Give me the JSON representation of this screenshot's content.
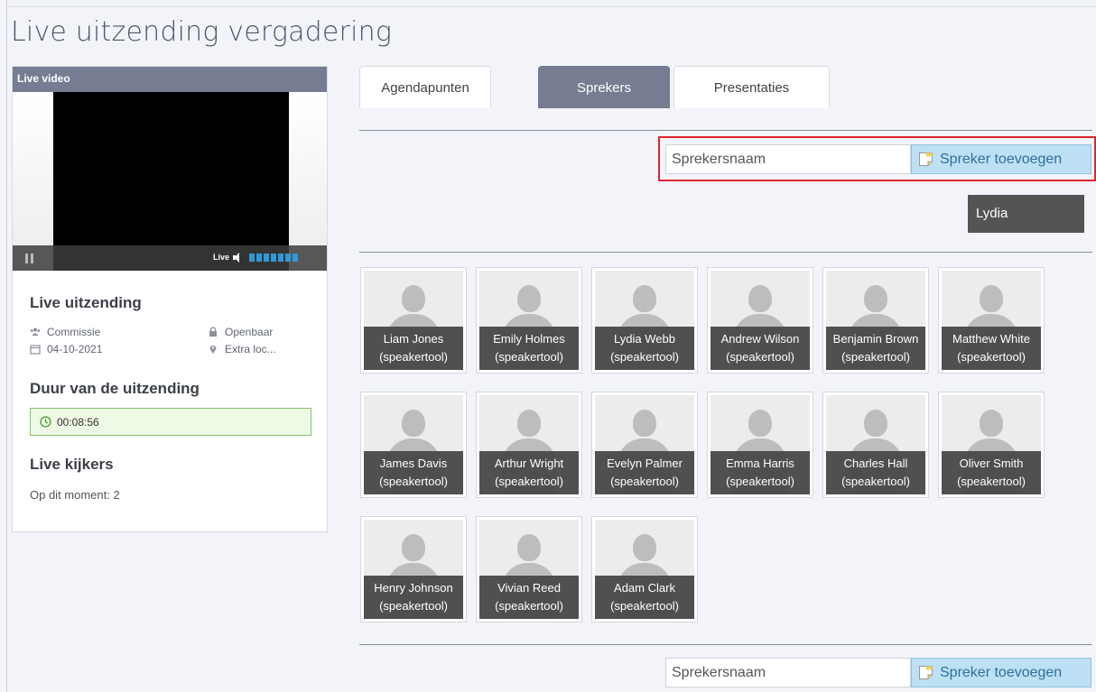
{
  "page": {
    "title": "Live uitzending vergadering"
  },
  "left_panel": {
    "video_header": "Live video",
    "live_label": "Live",
    "info_title": "Live uitzending",
    "meta": {
      "category": "Commissie",
      "date": "04-10-2021",
      "visibility": "Openbaar",
      "location": "Extra loc..."
    },
    "duration_title": "Duur van de uitzending",
    "duration": "00:08:56",
    "viewers_title": "Live kijkers",
    "viewers_text": "Op dit moment: 2"
  },
  "tabs": [
    {
      "label": "Agendapunten"
    },
    {
      "label": "Sprekers",
      "active": true
    },
    {
      "label": "Presentaties"
    }
  ],
  "add_speaker": {
    "placeholder": "Sprekersnaam",
    "button_label": "Spreker toevoegen"
  },
  "selected_speaker": "Lydia",
  "speakers": [
    {
      "name": "Liam Jones",
      "role": "(speakertool)"
    },
    {
      "name": "Emily Holmes",
      "role": "(speakertool)"
    },
    {
      "name": "Lydia Webb",
      "role": "(speakertool)"
    },
    {
      "name": "Andrew Wilson",
      "role": "(speakertool)"
    },
    {
      "name": "Benjamin Brown",
      "role": "(speakertool)"
    },
    {
      "name": "Matthew White",
      "role": "(speakertool)"
    },
    {
      "name": "James Davis",
      "role": "(speakertool)"
    },
    {
      "name": "Arthur Wright",
      "role": "(speakertool)"
    },
    {
      "name": "Evelyn Palmer",
      "role": "(speakertool)"
    },
    {
      "name": "Emma Harris",
      "role": "(speakertool)"
    },
    {
      "name": "Charles Hall",
      "role": "(speakertool)"
    },
    {
      "name": "Oliver Smith",
      "role": "(speakertool)"
    },
    {
      "name": "Henry Johnson",
      "role": "(speakertool)"
    },
    {
      "name": "Vivian Reed",
      "role": "(speakertool)"
    },
    {
      "name": "Adam Clark",
      "role": "(speakertool)"
    }
  ],
  "colors": {
    "tab_active": "#767d92",
    "button_bg": "#bde0f4",
    "highlight": "#e0252e",
    "duration_border": "#7fc46a"
  }
}
